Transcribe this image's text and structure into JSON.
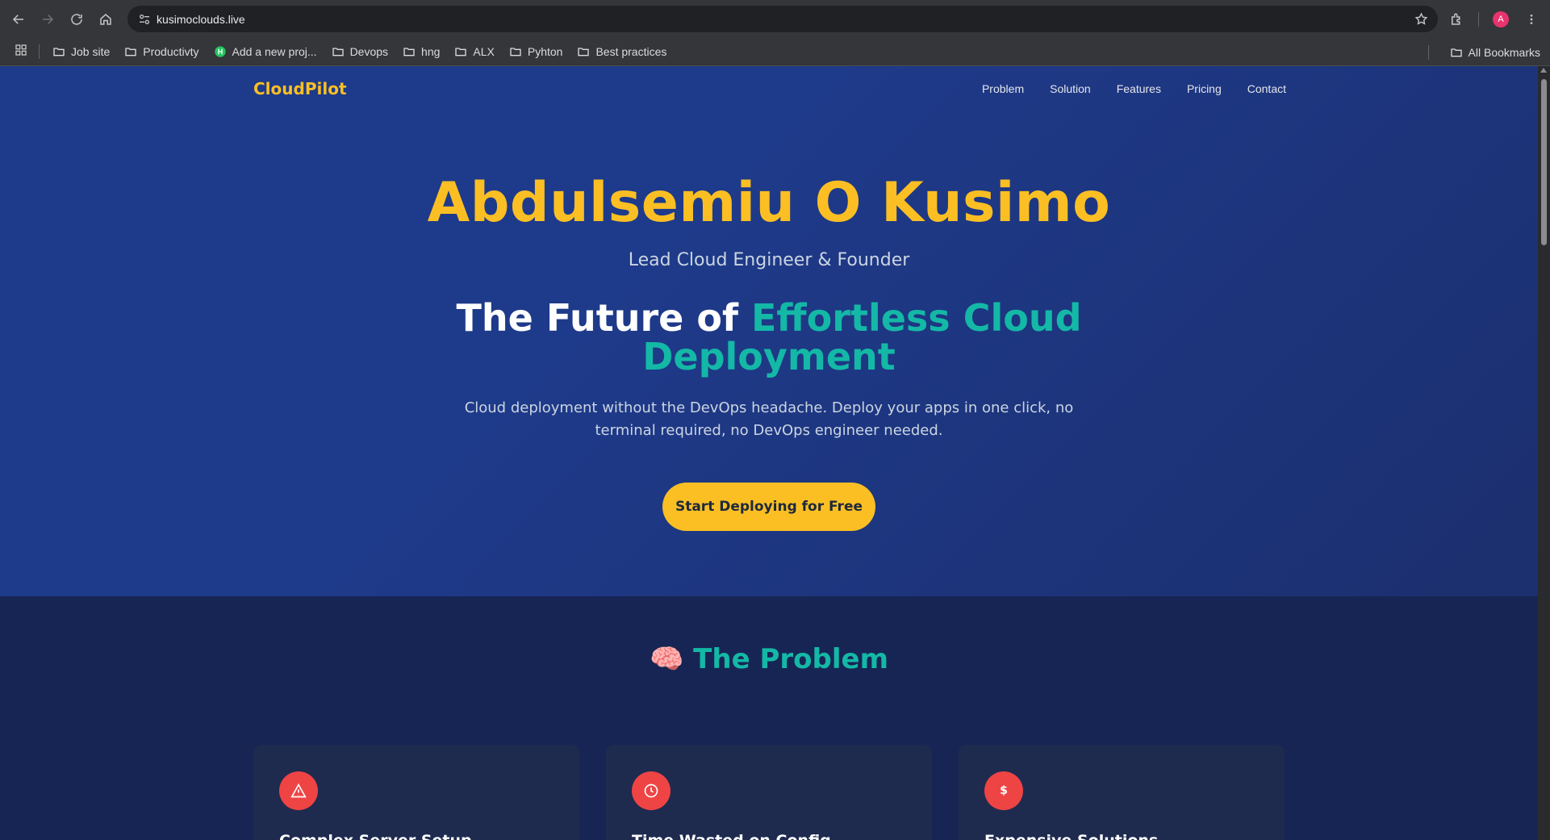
{
  "browser": {
    "url": "kusimoclouds.live",
    "avatar_letter": "A",
    "bookmarks": [
      {
        "label": "Job site",
        "icon": "folder-icon"
      },
      {
        "label": "Productivty",
        "icon": "folder-icon"
      },
      {
        "label": "Add a new proj...",
        "icon": "site-favicon"
      },
      {
        "label": "Devops",
        "icon": "folder-icon"
      },
      {
        "label": "hng",
        "icon": "folder-icon"
      },
      {
        "label": "ALX",
        "icon": "folder-icon"
      },
      {
        "label": "Pyhton",
        "icon": "folder-icon"
      },
      {
        "label": "Best practices",
        "icon": "folder-icon"
      }
    ],
    "all_bookmarks": "All Bookmarks"
  },
  "site": {
    "logo": "CloudPilot",
    "nav": [
      "Problem",
      "Solution",
      "Features",
      "Pricing",
      "Contact"
    ]
  },
  "hero": {
    "name": "Abdulsemiu O Kusimo",
    "role": "Lead Cloud Engineer & Founder",
    "tagline_prefix": "The Future of ",
    "tagline_accent": "Effortless Cloud Deployment",
    "description": "Cloud deployment without the DevOps headache. Deploy your apps in one click, no terminal required, no DevOps engineer needed.",
    "cta": "Start Deploying for Free"
  },
  "problem": {
    "emoji": "🧠",
    "title": "The Problem",
    "cards": [
      {
        "title": "Complex Server Setup",
        "icon": "warning-icon"
      },
      {
        "title": "Time Wasted on Config",
        "icon": "clock-icon"
      },
      {
        "title": "Expensive Solutions",
        "icon": "dollar-icon",
        "icon_text": "$"
      }
    ]
  },
  "colors": {
    "accent_yellow": "#fbbf24",
    "accent_teal": "#14b8a6",
    "hero_bg": "#1e3a8a",
    "section_bg": "#172554",
    "icon_red": "#ef4444"
  }
}
